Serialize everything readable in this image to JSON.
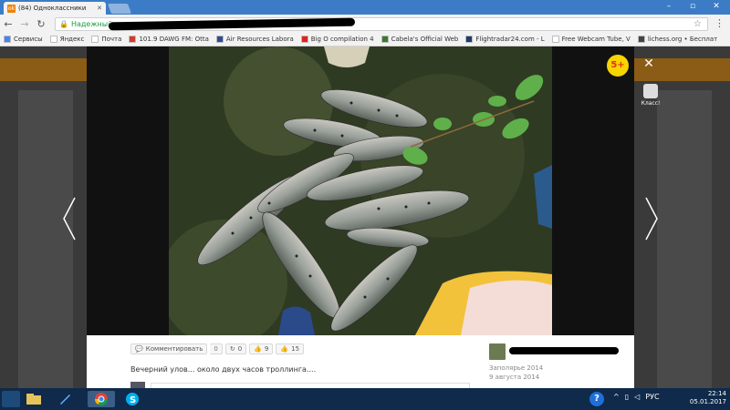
{
  "browser": {
    "tab_title": "(84) Одноклассники",
    "tab_favicon": "ok-icon",
    "url_secure_label": "Надежный",
    "bookmarks": [
      {
        "label": "Сервисы",
        "color": "#4285f4"
      },
      {
        "label": "Яндекс",
        "color": "#ffffff"
      },
      {
        "label": "Почта",
        "color": "#ffffff"
      },
      {
        "label": "101.9 DAWG FM: Otta",
        "color": "#d13c2f"
      },
      {
        "label": "Air Resources Labora",
        "color": "#2d4f8f"
      },
      {
        "label": "Big O compilation 4",
        "color": "#e0231c"
      },
      {
        "label": "Cabela's Official Web",
        "color": "#3a7a2e"
      },
      {
        "label": "Flightradar24.com - L",
        "color": "#1d3c6b"
      },
      {
        "label": "Free Webcam Tube, V",
        "color": "#ffffff"
      },
      {
        "label": "lichess.org • Бесплат",
        "color": "#444444"
      }
    ]
  },
  "viewer": {
    "badge": "5+",
    "close_icon": "close-icon",
    "klass_label": "Класс!",
    "actions": {
      "comment_label": "Комментировать",
      "comment_count": "0",
      "reshare_count": "0",
      "like_count": "9",
      "views_count": "15"
    },
    "description": "Вечерний улов... около двух часов троллинга....",
    "location": "Заполярье 2014",
    "date": "9 августа 2014"
  },
  "taskbar": {
    "language": "РУС",
    "time": "22:14",
    "date": "05.01.2017"
  }
}
